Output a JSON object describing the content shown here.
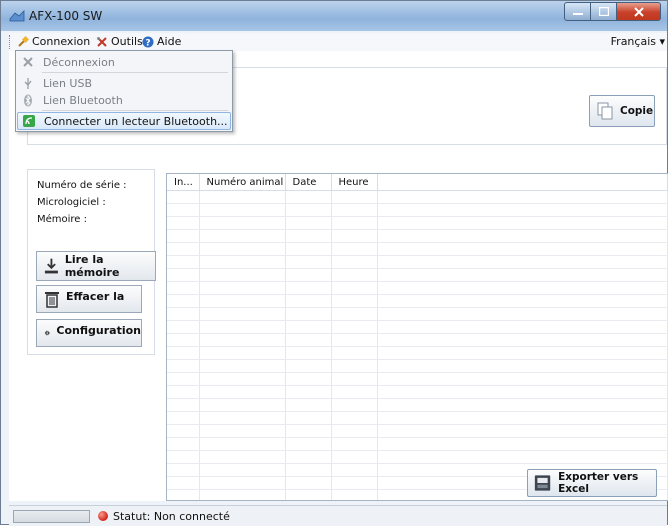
{
  "window": {
    "title": "AFX-100 SW",
    "controls": {
      "minimize": "minimize",
      "maximize": "maximize",
      "close": "close"
    }
  },
  "menubar": {
    "items": [
      {
        "label": "Connexion",
        "icon": "plug-icon"
      },
      {
        "label": "Outils",
        "icon": "tools-icon"
      },
      {
        "label": "Aide",
        "icon": "help-icon"
      }
    ],
    "language": "Français ▾"
  },
  "connexion_menu": {
    "items": [
      {
        "label": "Déconnexion",
        "icon": "disconnect-icon",
        "enabled": false
      },
      {
        "label": "Lien USB",
        "icon": "usb-icon",
        "enabled": false
      },
      {
        "label": "Lien Bluetooth",
        "icon": "bluetooth-icon",
        "enabled": false
      },
      {
        "label": "Connecter un lecteur Bluetooth...",
        "icon": "reader-icon",
        "enabled": true,
        "highlighted": true
      }
    ]
  },
  "top_panel": {
    "copy_button": "Copie"
  },
  "device_info": {
    "serial": "Numéro de série :",
    "firmware": "Micrologiciel :",
    "memory": "Mémoire :"
  },
  "actions": {
    "read_memory": "Lire la mémoire",
    "erase": "Effacer la",
    "configuration": "Configuration"
  },
  "table": {
    "columns": [
      "In...",
      "Numéro animal",
      "Date",
      "Heure"
    ],
    "rows": []
  },
  "export_button": "Exporter vers Excel",
  "status": {
    "text": "Statut: Non connecté",
    "color": "#d3231a"
  }
}
